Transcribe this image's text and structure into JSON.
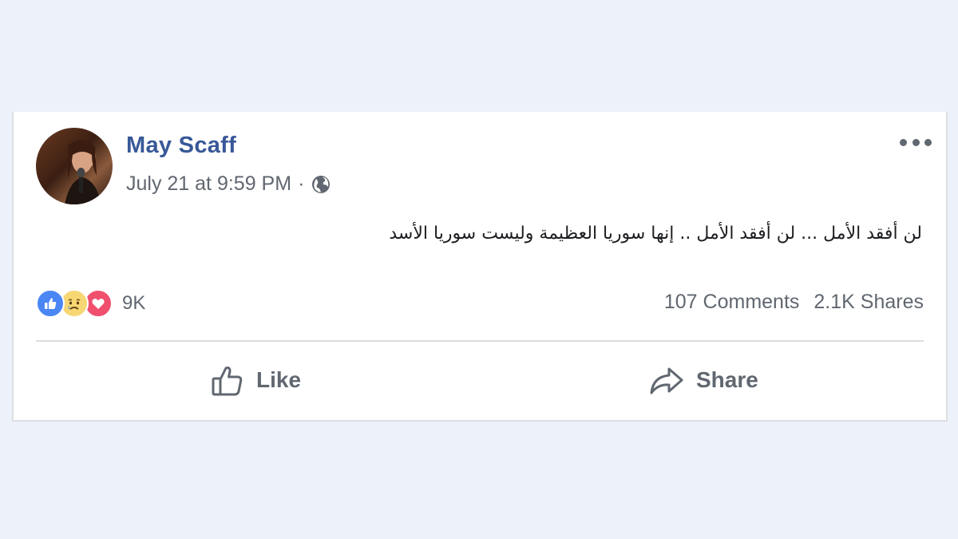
{
  "post": {
    "author": "May Scaff",
    "timestamp": "July 21 at 9:59 PM",
    "separator": "·",
    "privacy_icon": "globe-icon",
    "text": "لن أفقد الأمل ... لن أفقد الأمل .. إنها سوريا العظيمة وليست سوريا الأسد"
  },
  "reactions": {
    "types": [
      "like",
      "sad",
      "love"
    ],
    "count": "9K"
  },
  "stats": {
    "comments": "107 Comments",
    "shares": "2.1K Shares"
  },
  "actions": {
    "like_label": "Like",
    "share_label": "Share"
  },
  "colors": {
    "background": "#edf1f9",
    "name": "#385898",
    "secondary_text": "#606770",
    "like_blue": "#4b86f5",
    "love_red": "#f0506e",
    "sad_yellow": "#f7d774"
  }
}
